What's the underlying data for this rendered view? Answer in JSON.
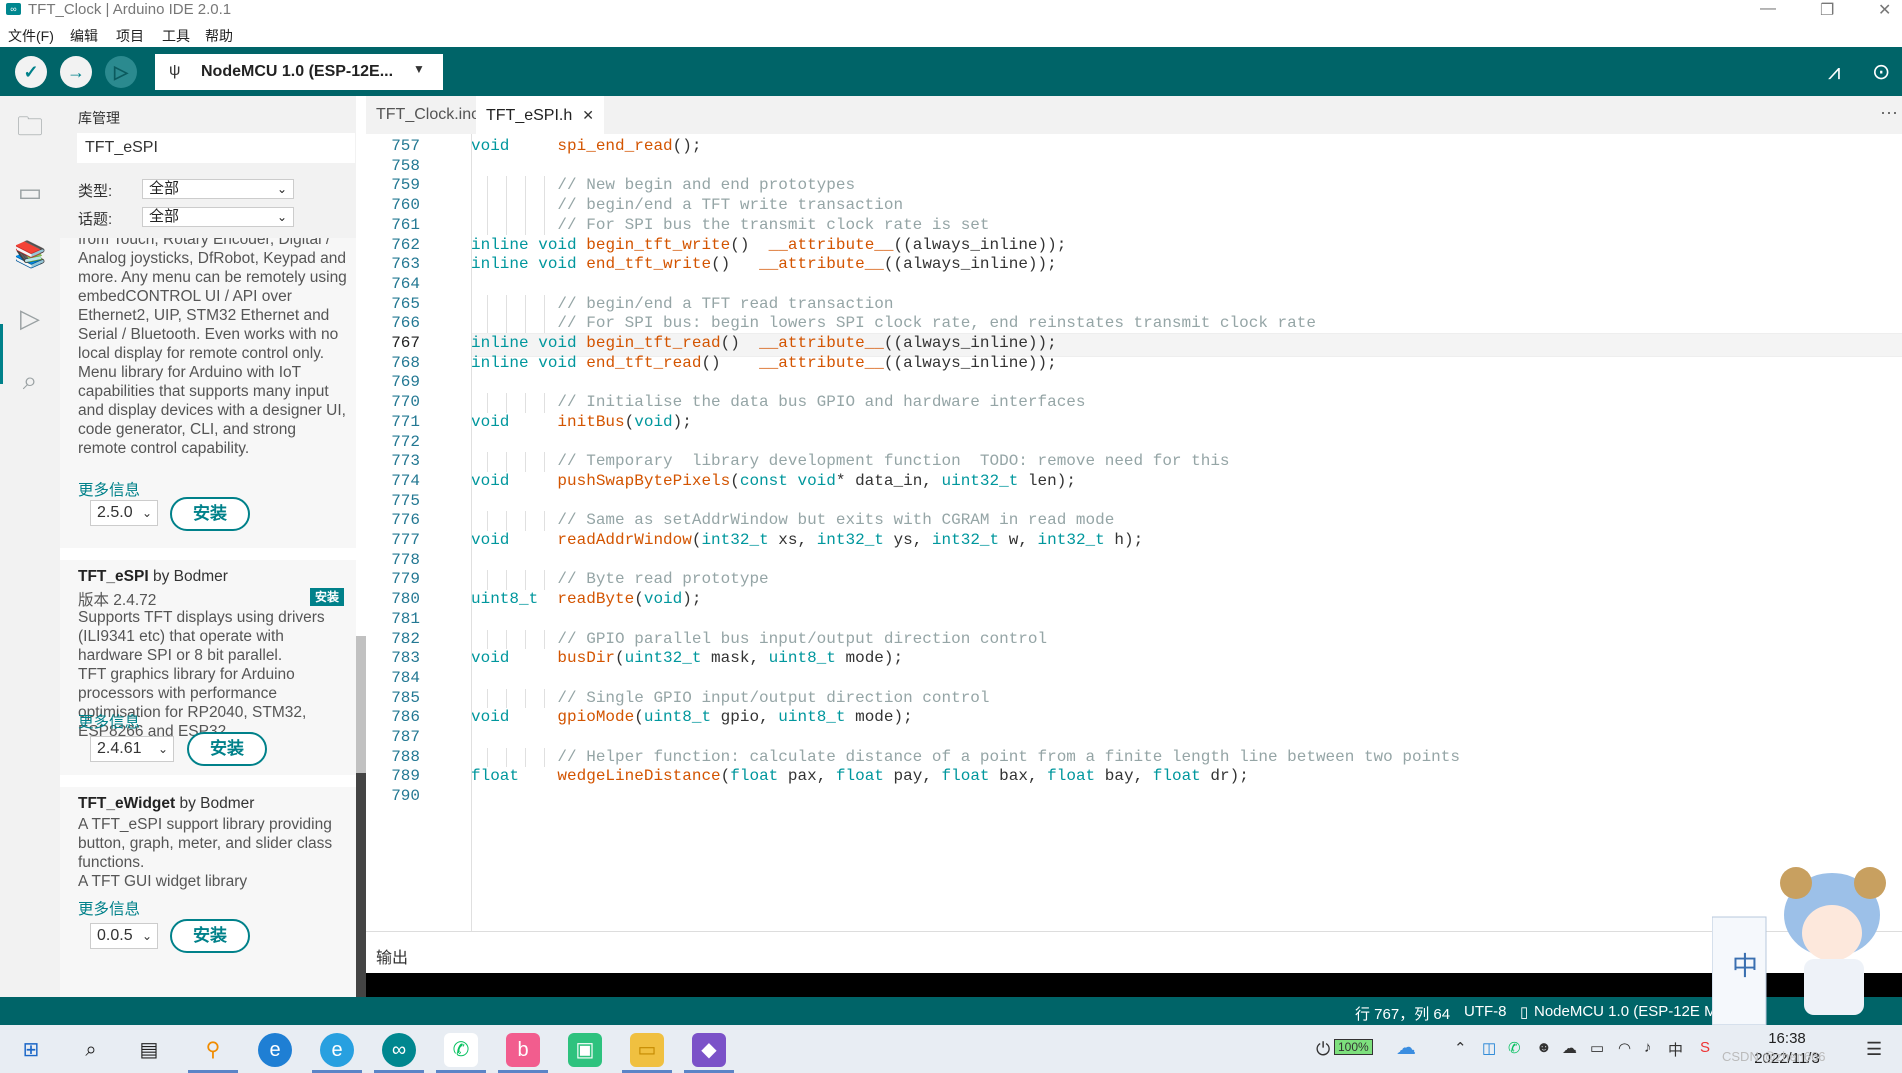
{
  "window": {
    "title": "TFT_Clock | Arduino IDE 2.0.1",
    "min": "—",
    "max": "❐",
    "close": "✕"
  },
  "menu": [
    "文件(F)",
    "编辑",
    "项目",
    "工具",
    "帮助"
  ],
  "toolbar": {
    "verify_icon": "check-icon",
    "upload_icon": "arrow-right-icon",
    "debug_icon": "debug-icon",
    "board": "NodeMCU 1.0 (ESP-12E...",
    "board_dropdown": "▼",
    "serial_plotter": "⩘",
    "serial_monitor": "⊙"
  },
  "activity": {
    "folder": "🗀",
    "boards": "▭",
    "library": "📚",
    "debug": "▷",
    "search": "⌕"
  },
  "library": {
    "title": "库管理",
    "search_value": "TFT_eSPI",
    "type_label": "类型:",
    "type_value": "全部",
    "topic_label": "话题:",
    "topic_value": "全部",
    "cards": [
      {
        "desc": "from Touch, Rotary Encoder, Digital / Analog joysticks, DfRobot, Keypad and more. Any menu can be remotely using embedCONTROL UI / API over Ethernet2, UIP, STM32 Ethernet and Serial / Bluetooth. Even works with no local display for remote control only.\nMenu library for Arduino with IoT capabilities that supports many input and display devices with a designer UI, code generator, CLI, and strong remote control capability.",
        "more": "更多信息",
        "version": "2.5.0",
        "install": "安装"
      },
      {
        "name": "TFT_eSPI",
        "by": "by",
        "author": "Bodmer",
        "badge": "安装",
        "version_label": "版本 2.4.72",
        "desc": "Supports TFT displays using drivers (ILI9341 etc) that operate with hardware SPI or 8 bit parallel.\nTFT graphics library for Arduino processors with performance optimisation for RP2040, STM32, ESP8266 and ESP32",
        "more": "更多信息",
        "version": "2.4.61",
        "install": "安装"
      },
      {
        "name": "TFT_eWidget",
        "by": "by",
        "author": "Bodmer",
        "desc": "A TFT_eSPI support library providing button, graph, meter, and slider class functions.\nA TFT GUI widget library",
        "more": "更多信息",
        "version": "0.0.5",
        "install": "安装"
      }
    ]
  },
  "tabs": [
    {
      "label": "TFT_Clock.ino"
    },
    {
      "label": "TFT_eSPI.h",
      "close": "✕"
    }
  ],
  "tabs_more": "⋯",
  "editor": {
    "current_line": 767,
    "lines": [
      {
        "n": "757",
        "guides": 0,
        "html": "<span class='kw'>void</span>     <span class='fn'>spi_end_read</span>();"
      },
      {
        "n": "758",
        "guides": 0,
        "html": ""
      },
      {
        "n": "759",
        "guides": 4,
        "html": "         <span class='cm'>// New begin and end prototypes</span>"
      },
      {
        "n": "760",
        "guides": 4,
        "html": "         <span class='cm'>// begin/end a TFT write transaction</span>"
      },
      {
        "n": "761",
        "guides": 4,
        "html": "         <span class='cm'>// For SPI bus the transmit clock rate is set</span>"
      },
      {
        "n": "762",
        "guides": 0,
        "html": "<span class='kw'>inline void</span> <span class='fn'>begin_tft_write</span>()  <span class='fn'>__attribute__</span>((always_inline));"
      },
      {
        "n": "763",
        "guides": 0,
        "html": "<span class='kw'>inline void</span> <span class='fn'>end_tft_write</span>()   <span class='fn'>__attribute__</span>((always_inline));"
      },
      {
        "n": "764",
        "guides": 0,
        "html": ""
      },
      {
        "n": "765",
        "guides": 4,
        "html": "         <span class='cm'>// begin/end a TFT read transaction</span>"
      },
      {
        "n": "766",
        "guides": 4,
        "html": "         <span class='cm'>// For SPI bus: begin lowers SPI clock rate, end reinstates transmit clock rate</span>"
      },
      {
        "n": "767",
        "guides": 0,
        "html": "<span class='kw'>inline void</span> <span class='fn'>begin_tft_read</span>()  <span class='fn'>__attribute__</span>((always_inline));"
      },
      {
        "n": "768",
        "guides": 0,
        "html": "<span class='kw'>inline void</span> <span class='fn'>end_tft_read</span>()    <span class='fn'>__attribute__</span>((always_inline));"
      },
      {
        "n": "769",
        "guides": 0,
        "html": ""
      },
      {
        "n": "770",
        "guides": 4,
        "html": "         <span class='cm'>// Initialise the data bus GPIO and hardware interfaces</span>"
      },
      {
        "n": "771",
        "guides": 0,
        "html": "<span class='kw'>void</span>     <span class='fn'>initBus</span>(<span class='kw'>void</span>);"
      },
      {
        "n": "772",
        "guides": 0,
        "html": ""
      },
      {
        "n": "773",
        "guides": 4,
        "html": "         <span class='cm'>// Temporary  library development function  TODO: remove need for this</span>"
      },
      {
        "n": "774",
        "guides": 0,
        "html": "<span class='kw'>void</span>     <span class='fn'>pushSwapBytePixels</span>(<span class='kw'>const void</span>* data_in, <span class='ty'>uint32_t</span> len);"
      },
      {
        "n": "775",
        "guides": 0,
        "html": ""
      },
      {
        "n": "776",
        "guides": 4,
        "html": "         <span class='cm'>// Same as setAddrWindow but exits with CGRAM in read mode</span>"
      },
      {
        "n": "777",
        "guides": 0,
        "html": "<span class='kw'>void</span>     <span class='fn'>readAddrWindow</span>(<span class='ty'>int32_t</span> xs, <span class='ty'>int32_t</span> ys, <span class='ty'>int32_t</span> w, <span class='ty'>int32_t</span> h);"
      },
      {
        "n": "778",
        "guides": 0,
        "html": ""
      },
      {
        "n": "779",
        "guides": 4,
        "html": "         <span class='cm'>// Byte read prototype</span>"
      },
      {
        "n": "780",
        "guides": 0,
        "html": "<span class='ty'>uint8_t</span>  <span class='fn'>readByte</span>(<span class='kw'>void</span>);"
      },
      {
        "n": "781",
        "guides": 0,
        "html": ""
      },
      {
        "n": "782",
        "guides": 4,
        "html": "         <span class='cm'>// GPIO parallel bus input/output direction control</span>"
      },
      {
        "n": "783",
        "guides": 0,
        "html": "<span class='kw'>void</span>     <span class='fn'>busDir</span>(<span class='ty'>uint32_t</span> mask, <span class='ty'>uint8_t</span> mode);"
      },
      {
        "n": "784",
        "guides": 0,
        "html": ""
      },
      {
        "n": "785",
        "guides": 4,
        "html": "         <span class='cm'>// Single GPIO input/output direction control</span>"
      },
      {
        "n": "786",
        "guides": 0,
        "html": "<span class='kw'>void</span>     <span class='fn'>gpioMode</span>(<span class='ty'>uint8_t</span> gpio, <span class='ty'>uint8_t</span> mode);"
      },
      {
        "n": "787",
        "guides": 0,
        "html": ""
      },
      {
        "n": "788",
        "guides": 4,
        "html": "         <span class='cm'>// Helper function: calculate distance of a point from a finite length line between two points</span>"
      },
      {
        "n": "789",
        "guides": 0,
        "html": "<span class='kw'>float</span>    <span class='fn'>wedgeLineDistance</span>(<span class='kw'>float</span> pax, <span class='kw'>float</span> pay, <span class='kw'>float</span> bax, <span class='kw'>float</span> bay, <span class='kw'>float</span> dr);"
      },
      {
        "n": "790",
        "guides": 0,
        "html": ""
      }
    ]
  },
  "output": {
    "label": "输出"
  },
  "status": {
    "position": "行 767，列 64",
    "encoding": "UTF-8",
    "board": "NodeMCU 1.0 (ESP-12E Mo",
    "chip": "▯"
  },
  "taskbar": {
    "apps": [
      "windows-icon",
      "search-icon",
      "task-view-icon",
      "magnifier-app-icon",
      "edge-icon",
      "edge-alt-icon",
      "arduino-icon",
      "wechat-icon",
      "bilibili-icon",
      "app-green-icon",
      "explorer-icon",
      "visual-studio-icon"
    ],
    "battery": "100%",
    "ime": "中",
    "time": "16:38",
    "date": "2022/11/3",
    "watermark": "CSDN @zhen666"
  },
  "colors": {
    "accent": "#00818a",
    "toolbar": "#006468",
    "comment": "#95a5a6",
    "keyword": "#00979d",
    "function": "#d35400"
  }
}
